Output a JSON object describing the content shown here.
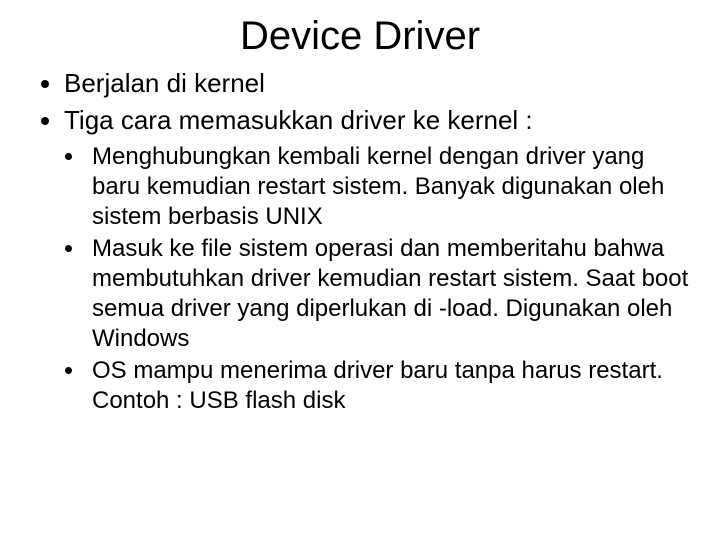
{
  "title": "Device Driver",
  "bullets": [
    "Berjalan di kernel",
    "Tiga cara memasukkan driver ke kernel :"
  ],
  "subbullets": [
    "Menghubungkan kembali kernel dengan driver yang baru kemudian restart sistem. Banyak digunakan oleh sistem berbasis UNIX",
    "Masuk ke file sistem operasi dan memberitahu bahwa membutuhkan driver kemudian restart sistem. Saat boot semua driver yang diperlukan di -load. Digunakan oleh Windows",
    "OS mampu menerima driver baru tanpa harus restart. Contoh : USB flash disk"
  ]
}
